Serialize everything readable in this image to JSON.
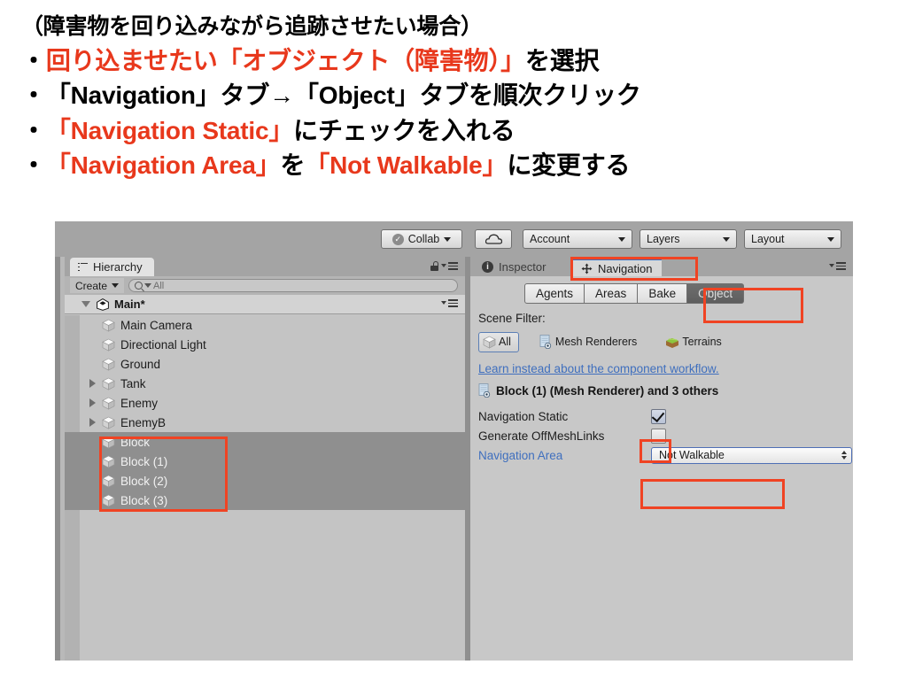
{
  "slide": {
    "heading": "（障害物を回り込みながら追跡させたい場合）",
    "bullets": [
      {
        "mark": "・",
        "segments": [
          {
            "t": "回り込ませたい「オブジェクト（障害物）」",
            "c": "red"
          },
          {
            "t": "を選択",
            "c": "blk"
          }
        ]
      },
      {
        "mark": "・",
        "segments": [
          {
            "t": "「Navigation」タブ→「Object」タブを順次クリック",
            "c": "blk"
          }
        ]
      },
      {
        "mark": "・",
        "segments": [
          {
            "t": "「Navigation Static」",
            "c": "red"
          },
          {
            "t": "にチェックを入れる",
            "c": "blk"
          }
        ]
      },
      {
        "mark": "・",
        "segments": [
          {
            "t": "「Navigation Area」",
            "c": "red"
          },
          {
            "t": "を",
            "c": "blk"
          },
          {
            "t": "「Not Walkable」",
            "c": "red"
          },
          {
            "t": "に変更する",
            "c": "blk"
          }
        ]
      }
    ]
  },
  "colors": {
    "annotation_red": "#f04323",
    "text_red": "#e8381c",
    "link_blue": "#3f6fbe",
    "tab_active_blue": "#3f6fbe",
    "panel_grey": "#c8c8c8",
    "selection_grey": "#8f8f8f"
  },
  "editor": {
    "toolbar": {
      "collab_label": "Collab",
      "cloud_icon": "cloud-icon",
      "account_label": "Account",
      "layers_label": "Layers",
      "layout_label": "Layout"
    },
    "hierarchy": {
      "tab_label": "Hierarchy",
      "create_label": "Create",
      "search_value": "All",
      "search_placeholder": "All",
      "scene_name": "Main*",
      "items": [
        {
          "label": "Main Camera",
          "expandable": false,
          "selected": false
        },
        {
          "label": "Directional Light",
          "expandable": false,
          "selected": false
        },
        {
          "label": "Ground",
          "expandable": false,
          "selected": false
        },
        {
          "label": "Tank",
          "expandable": true,
          "selected": false
        },
        {
          "label": "Enemy",
          "expandable": true,
          "selected": false
        },
        {
          "label": "EnemyB",
          "expandable": true,
          "selected": false
        },
        {
          "label": "Block",
          "expandable": false,
          "selected": true
        },
        {
          "label": "Block (1)",
          "expandable": false,
          "selected": true
        },
        {
          "label": "Block (2)",
          "expandable": false,
          "selected": true
        },
        {
          "label": "Block (3)",
          "expandable": false,
          "selected": true
        }
      ]
    },
    "inspector": {
      "inspector_tab_label": "Inspector",
      "navigation_tab_label": "Navigation",
      "subtabs": [
        {
          "label": "Agents",
          "active": false
        },
        {
          "label": "Areas",
          "active": false
        },
        {
          "label": "Bake",
          "active": false
        },
        {
          "label": "Object",
          "active": true
        }
      ],
      "scene_filter_label": "Scene Filter:",
      "filters": [
        {
          "label": "All",
          "selected": true
        },
        {
          "label": "Mesh Renderers",
          "selected": false
        },
        {
          "label": "Terrains",
          "selected": false
        }
      ],
      "learn_link": "Learn instead about the component workflow.",
      "object_title": "Block (1) (Mesh Renderer) and 3 others",
      "navigation_static_label": "Navigation Static",
      "navigation_static_checked": "✓",
      "generate_offmeshlinks_label": "Generate OffMeshLinks",
      "navigation_area_label": "Navigation Area",
      "navigation_area_value": "Not Walkable"
    }
  }
}
